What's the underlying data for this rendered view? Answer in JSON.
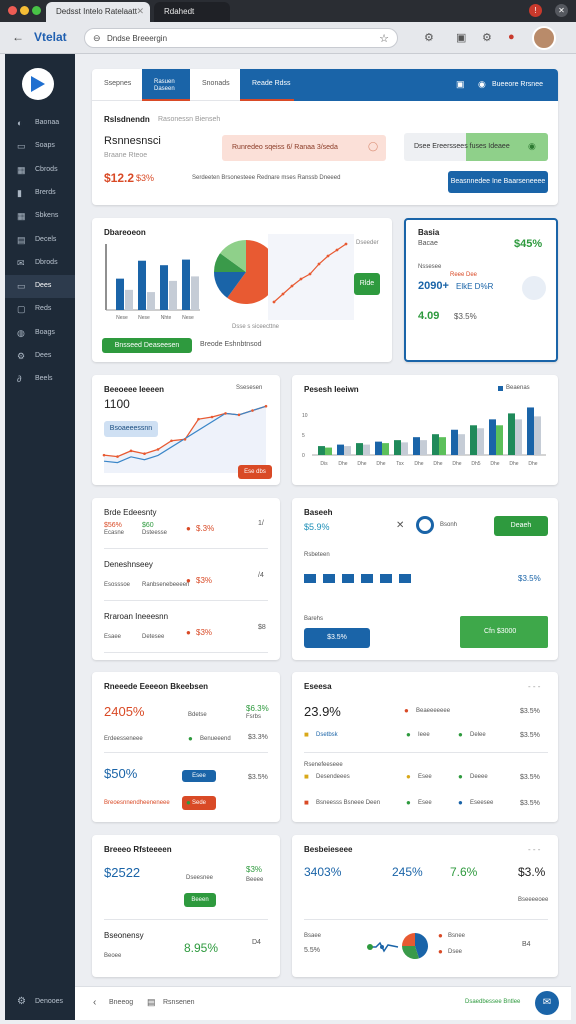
{
  "browser": {
    "tabs": [
      {
        "label": "Dedsst Intelo Ratelaatt"
      },
      {
        "label": "Rdahedt"
      }
    ],
    "address": "Dndse Breeergin",
    "brand": "Vtelat"
  },
  "sidebar": {
    "items": [
      {
        "label": "Baonaa",
        "icon": "gauge-icon"
      },
      {
        "label": "Soaps",
        "icon": "chat-icon"
      },
      {
        "label": "Cbrods",
        "icon": "calendar-icon"
      },
      {
        "label": "Brerds",
        "icon": "chart-icon"
      },
      {
        "label": "Sbkens",
        "icon": "grid-icon"
      },
      {
        "label": "Decels",
        "icon": "doc-icon"
      },
      {
        "label": "Dbrods",
        "icon": "mail-icon"
      },
      {
        "label": "Dees",
        "icon": "folder-icon"
      },
      {
        "label": "Reds",
        "icon": "box-icon"
      },
      {
        "label": "Boags",
        "icon": "globe-icon"
      },
      {
        "label": "Dees",
        "icon": "gear-icon"
      },
      {
        "label": "Beels",
        "icon": "link-icon"
      }
    ],
    "footer": "Denooes"
  },
  "header": {
    "tabs": [
      "Ssepnes",
      "Rasuen Daseen",
      "Snonads",
      "Reade Rdss"
    ],
    "right_link": "Bueeore Rrsnee",
    "title": "Rslsdnendn",
    "title_meta": "Rasonessn Bienseh",
    "subtitle": "Rsnnesnsci",
    "subnote": "Braane Rteoe",
    "alert_pink": "Runredeo sqeiss 6/ Ranaa 3/seda",
    "alert_green": "Dsee Ereerssees fuses Ideaee",
    "kpi1": "$12.2",
    "kpi2": "$3%",
    "kpi_note": "Serdeeten Brsonesteee Rednare mses Ranssb Dneeed",
    "button": "Beasnnedee Ine Baarseneeee"
  },
  "overview": {
    "title": "Dbareoeon",
    "bar_labels": [
      "Nese",
      "Nese",
      "Nhte",
      "Nese"
    ],
    "button": "Bnsseed Deaseesen",
    "link": "Breode Eshnbtnsod",
    "pie_caption": "Dsse s siceecttne",
    "line_label": "Dseeder",
    "line_badge": "Rlde"
  },
  "side_kpi": {
    "title": "Basia",
    "sub": "Bacae",
    "pct": "$45%",
    "line1": "Nssesee",
    "line2": "Reee Dee",
    "v1": "2090+",
    "v1b": "ElkE D%R",
    "v2": "4.09",
    "v2b": "$3.5%"
  },
  "trend": {
    "title": "Beeoeee Ieeeen",
    "right": "Ssesesen",
    "value": "1100",
    "tag": "Bsoaeeessnn",
    "badge": "Ese dbs"
  },
  "bars": {
    "title": "Pesesh Ieeiwn",
    "legend": "Beaenas",
    "xlabels": [
      "Dis",
      "Dhe",
      "Dhe",
      "Dhe",
      "Tsx",
      "Dhe",
      "Dhe",
      "Dhe",
      "Dh5",
      "Dhe",
      "Dhe",
      "Dhe"
    ]
  },
  "metrics_left": {
    "rows": [
      {
        "title": "Brde Edeesnty",
        "a": "$56%",
        "b": "$60",
        "c": "$.3%",
        "sa": "Ecasne",
        "sb": "Dsteesse",
        "end": "1/"
      },
      {
        "title": "Deneshnseey",
        "a": "",
        "b": "",
        "c": "$3%",
        "sa": "Esosssoe",
        "sb": "Ranbsenebeeeen",
        "end": "/4"
      },
      {
        "title": "Rraroan Ineeesnn",
        "a": "",
        "b": "",
        "c": "$3%",
        "sa": "Esaee",
        "sb": "Detesee",
        "end": "$8"
      }
    ]
  },
  "metrics_right": {
    "title": "Baseeh",
    "pct": "$5.9%",
    "mid": "Bsonh",
    "button1": "Deaeh",
    "row2": "Rsbeteen",
    "row2val": "$3.5%",
    "row3": "Barehs",
    "bar_btn": "$3.5%",
    "button2": "Cfn $3000"
  },
  "nets_left": {
    "title": "Rneeede Eeeeon Bkeebsen",
    "pct": "2405%",
    "pct_note": "Bdetse",
    "right_top": "$6.3%",
    "right_top2": "Fsrbs",
    "row_a_label": "Erdeesseneee",
    "row_a_icon": "Benueeend",
    "row_a_val": "$3.3%",
    "pct2": "$50%",
    "row_b": "Esee",
    "row_b2": "Edeeeanneen",
    "row_b_val": "$3.5%",
    "row_b_note": "Breoesnnendheeneneee",
    "row_b_end": "Sede"
  },
  "nets_right": {
    "title": "Eseesa",
    "pct": "23.9%",
    "rows": [
      {
        "a": "Beaeeeeeee",
        "b": "",
        "val": "$3.5%"
      },
      {
        "a": "Dsetbsk",
        "b": "Ieee",
        "c": "Delee",
        "val": "$3.5%"
      },
      {
        "a": "Desendeees",
        "b": "Esee",
        "c": "Deeee",
        "val": "$3.5%"
      },
      {
        "a": "Bsneesss Bsneee Deen",
        "b": "Esee",
        "c": "Eseesee",
        "val": "$3.5%"
      }
    ],
    "mid_label": "Rsenefeeseee"
  },
  "foot_left": {
    "title": "Breeeo Rfsteeeen",
    "v1": "$2522",
    "tag": "Dseesnee",
    "v1r": "$3%",
    "v1r2": "Beeee",
    "btn": "Beeen",
    "row2": "Bseonensy",
    "row2sub": "Beoee",
    "v2": "8.95%",
    "row2end": "D4"
  },
  "foot_right": {
    "title": "Besbeieseee",
    "v1": "3403%",
    "v2": "245%",
    "v3": "7.6%",
    "v4": "$3.%",
    "v4sub": "Bseeeeoee",
    "row2": "Bsaee",
    "row2sub": "5.5%",
    "legend1": "Bsnee",
    "legend2": "Dsee",
    "end": "B4"
  },
  "bottom": {
    "left1": "Bneeog",
    "left2": "Rsnsenen",
    "right": "Dsaedbessee Bntlee"
  },
  "chart_data": [
    {
      "type": "bar",
      "categories": [
        "Nese",
        "Nese",
        "Nhte",
        "Nese"
      ],
      "series": [
        {
          "values": [
            28,
            44,
            40,
            45
          ]
        },
        {
          "values": [
            18,
            16,
            26,
            30
          ]
        }
      ]
    },
    {
      "type": "pie",
      "values": [
        60,
        15,
        10,
        15
      ]
    },
    {
      "type": "line",
      "values": [
        12,
        20,
        28,
        35,
        40,
        50,
        58,
        64,
        70
      ]
    },
    {
      "type": "line",
      "values": [
        22,
        20,
        28,
        24,
        30,
        42,
        44,
        72,
        75,
        80,
        78,
        84,
        90
      ]
    },
    {
      "type": "bar",
      "categories": [
        "Dis",
        "Dhe",
        "Dhe",
        "Dhe",
        "Tsx",
        "Dhe",
        "Dhe",
        "Dhe",
        "Dh5",
        "Dhe",
        "Dhe",
        "Dhe"
      ],
      "series": [
        {
          "values": [
            12,
            14,
            16,
            18,
            20,
            24,
            28,
            34,
            40,
            48,
            56,
            64
          ]
        },
        {
          "values": [
            10,
            12,
            14,
            16,
            17,
            20,
            24,
            28,
            36,
            40,
            48,
            52
          ]
        }
      ]
    }
  ],
  "colors": {
    "accent": "#1a64a8",
    "red": "#d94a26",
    "green": "#2e9a3e",
    "sidebar": "#1e2a38"
  }
}
